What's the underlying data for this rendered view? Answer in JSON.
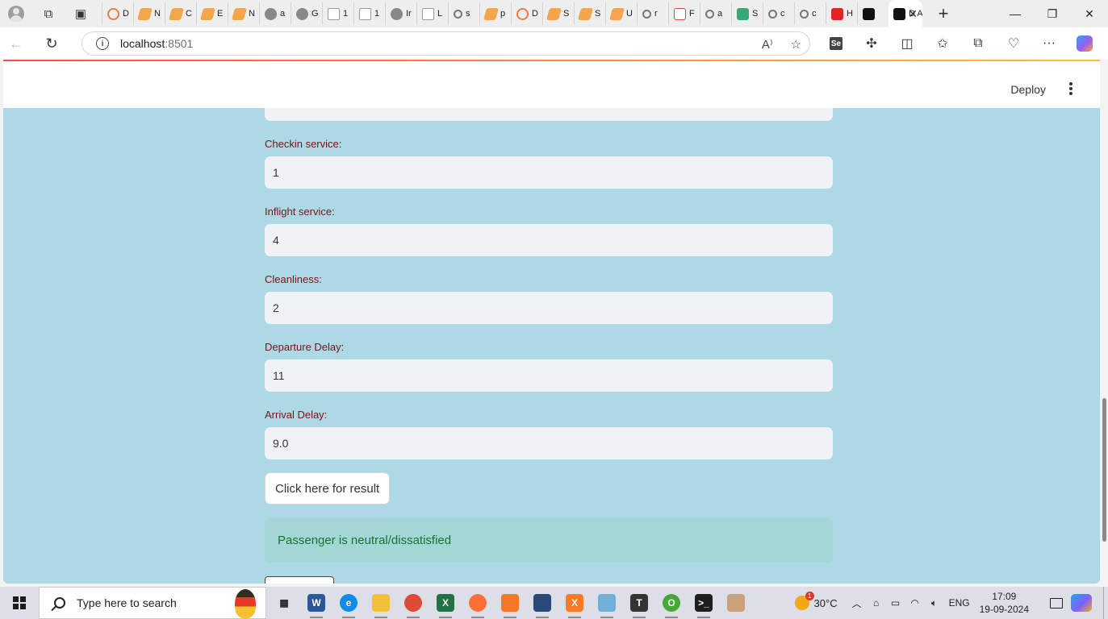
{
  "browser": {
    "tabs": [
      {
        "letter": "D",
        "favicon": "ring-icon"
      },
      {
        "letter": "N",
        "favicon": "orange-icon"
      },
      {
        "letter": "C",
        "favicon": "orange-icon"
      },
      {
        "letter": "E",
        "favicon": "orange-icon"
      },
      {
        "letter": "N",
        "favicon": "orange-icon"
      },
      {
        "letter": "a",
        "favicon": "github-icon"
      },
      {
        "letter": "G",
        "favicon": "github-icon"
      },
      {
        "letter": "1",
        "favicon": "document-icon"
      },
      {
        "letter": "1",
        "favicon": "document-icon"
      },
      {
        "letter": "Ir",
        "favicon": "github-icon"
      },
      {
        "letter": "L",
        "favicon": "document-icon"
      },
      {
        "letter": "s",
        "favicon": "search-icon"
      },
      {
        "letter": "p",
        "favicon": "orange-icon"
      },
      {
        "letter": "D",
        "favicon": "ring-icon"
      },
      {
        "letter": "S",
        "favicon": "orange-icon"
      },
      {
        "letter": "S",
        "favicon": "orange-icon"
      },
      {
        "letter": "U",
        "favicon": "orange-icon"
      },
      {
        "letter": "r",
        "favicon": "search-icon"
      },
      {
        "letter": "F",
        "favicon": "pdf-icon"
      },
      {
        "letter": "a",
        "favicon": "search-icon"
      },
      {
        "letter": "S",
        "favicon": "w-icon"
      },
      {
        "letter": "c",
        "favicon": "search-icon"
      },
      {
        "letter": "c",
        "favicon": "search-icon"
      },
      {
        "letter": "H",
        "favicon": "red-icon"
      },
      {
        "letter": "",
        "favicon": "md-icon"
      }
    ],
    "active_tab": {
      "letter": "D A",
      "close": "✕"
    },
    "new_tab": "+",
    "window_controls": {
      "minimize": "—",
      "restore": "❐",
      "close": "✕"
    },
    "address": {
      "host": "localhost",
      "port": ":8501"
    }
  },
  "app": {
    "deploy_label": "Deploy",
    "fields": [
      {
        "label": "Checkin service:",
        "value": "1"
      },
      {
        "label": "Inflight service:",
        "value": "4"
      },
      {
        "label": "Cleanliness:",
        "value": "2"
      },
      {
        "label": "Departure Delay:",
        "value": "11"
      },
      {
        "label": "Arrival Delay:",
        "value": "9.0"
      }
    ],
    "button_label": "Click here for result",
    "result_message": "Passenger is neutral/dissatisfied"
  },
  "taskbar": {
    "search_placeholder": "Type here to search",
    "apps": [
      {
        "name": "task-view-icon",
        "color": "#2b2b2b",
        "glyph": "▦"
      },
      {
        "name": "word-icon",
        "color": "#2b579a",
        "glyph": "W"
      },
      {
        "name": "edge-icon",
        "color": "#0c8ce9",
        "glyph": "e"
      },
      {
        "name": "file-explorer-icon",
        "color": "#f2c037",
        "glyph": ""
      },
      {
        "name": "chrome-icon",
        "color": "#dd4b39",
        "glyph": ""
      },
      {
        "name": "excel-icon",
        "color": "#217346",
        "glyph": "X"
      },
      {
        "name": "firefox-icon",
        "color": "#ff7139",
        "glyph": ""
      },
      {
        "name": "jupyter-icon",
        "color": "#f37726",
        "glyph": ""
      },
      {
        "name": "mysql-workbench-icon",
        "color": "#2a4a7b",
        "glyph": ""
      },
      {
        "name": "xampp-icon",
        "color": "#fb7a24",
        "glyph": "X"
      },
      {
        "name": "notepad-icon",
        "color": "#6fb0d9",
        "glyph": ""
      },
      {
        "name": "typora-icon",
        "color": "#333333",
        "glyph": "T"
      },
      {
        "name": "anaconda-icon",
        "color": "#44a833",
        "glyph": "O"
      },
      {
        "name": "terminal-icon",
        "color": "#1e1e1e",
        "glyph": ">_"
      },
      {
        "name": "paint-icon",
        "color": "#c9a27a",
        "glyph": ""
      }
    ],
    "weather_temp": "30°C",
    "language": "ENG",
    "time": "17:09",
    "date": "19-09-2024"
  }
}
